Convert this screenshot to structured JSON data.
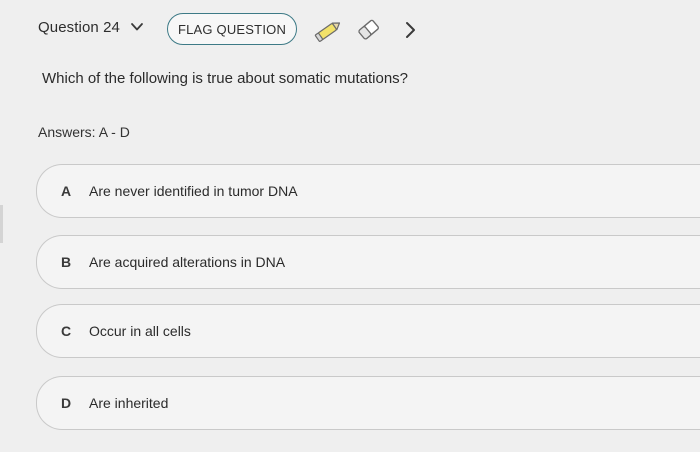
{
  "header": {
    "question_label": "Question 24",
    "flag_label": "FLAG QUESTION",
    "icons": {
      "dropdown": "chevron-down-icon",
      "highlighter": "pencil-icon",
      "eraser": "eraser-icon",
      "next": "chevron-right-icon"
    },
    "colors": {
      "flag_border": "#3d7a86",
      "pencil_fill": "#f2e26a"
    }
  },
  "question": {
    "text": "Which of the following is true about somatic mutations?"
  },
  "answers": {
    "label": "Answers: A - D",
    "options": [
      {
        "letter": "A",
        "text": "Are never identified in tumor DNA"
      },
      {
        "letter": "B",
        "text": "Are acquired alterations in DNA"
      },
      {
        "letter": "C",
        "text": "Occur in all cells"
      },
      {
        "letter": "D",
        "text": "Are inherited"
      }
    ]
  }
}
